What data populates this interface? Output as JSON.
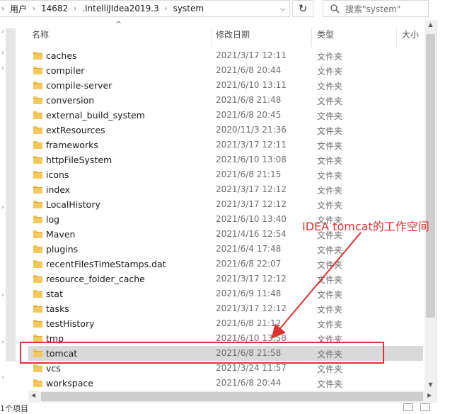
{
  "address": {
    "crumbs": [
      "用户",
      "14682",
      ".IntelliJIdea2019.3",
      "system"
    ],
    "search_placeholder": "搜索\"system\""
  },
  "columns": {
    "name": "名称",
    "date": "修改日期",
    "type": "类型",
    "size": "大小"
  },
  "files": [
    {
      "name": "caches",
      "date": "2021/3/17 12:11",
      "type": "文件夹"
    },
    {
      "name": "compiler",
      "date": "2021/6/8 20:44",
      "type": "文件夹"
    },
    {
      "name": "compile-server",
      "date": "2021/6/10 13:11",
      "type": "文件夹"
    },
    {
      "name": "conversion",
      "date": "2021/6/8 21:48",
      "type": "文件夹"
    },
    {
      "name": "external_build_system",
      "date": "2021/6/8 20:45",
      "type": "文件夹"
    },
    {
      "name": "extResources",
      "date": "2020/11/3 21:36",
      "type": "文件夹"
    },
    {
      "name": "frameworks",
      "date": "2021/3/17 12:11",
      "type": "文件夹"
    },
    {
      "name": "httpFileSystem",
      "date": "2021/6/10 13:08",
      "type": "文件夹"
    },
    {
      "name": "icons",
      "date": "2021/6/8 21:15",
      "type": "文件夹"
    },
    {
      "name": "index",
      "date": "2021/3/17 12:12",
      "type": "文件夹"
    },
    {
      "name": "LocalHistory",
      "date": "2021/3/17 12:12",
      "type": "文件夹"
    },
    {
      "name": "log",
      "date": "2021/6/10 13:40",
      "type": "文件夹"
    },
    {
      "name": "Maven",
      "date": "2021/4/16 12:54",
      "type": "文件夹"
    },
    {
      "name": "plugins",
      "date": "2021/6/4 17:48",
      "type": "文件夹"
    },
    {
      "name": "recentFilesTimeStamps.dat",
      "date": "2021/6/8 22:07",
      "type": "文件夹"
    },
    {
      "name": "resource_folder_cache",
      "date": "2021/3/17 12:12",
      "type": "文件夹"
    },
    {
      "name": "stat",
      "date": "2021/6/9 11:48",
      "type": "文件夹"
    },
    {
      "name": "tasks",
      "date": "2021/3/17 12:12",
      "type": "文件夹"
    },
    {
      "name": "testHistory",
      "date": "2021/6/8 21:12",
      "type": "文件夹"
    },
    {
      "name": "tmp",
      "date": "2021/6/10 13:58",
      "type": "文件夹"
    },
    {
      "name": "tomcat",
      "date": "2021/6/8 21:58",
      "type": "文件夹",
      "selected": true
    },
    {
      "name": "vcs",
      "date": "2021/3/24 11:57",
      "type": "文件夹"
    },
    {
      "name": "workspace",
      "date": "2021/6/8 20:44",
      "type": "文件夹"
    }
  ],
  "annotation": {
    "label": "IDEA tomcat的工作空间",
    "color": "#e03131"
  },
  "status": {
    "text": "1个项目"
  },
  "colors": {
    "folder": "#f4c85b",
    "folder_dark": "#e0aa35",
    "selection": "#d9d9d9"
  }
}
